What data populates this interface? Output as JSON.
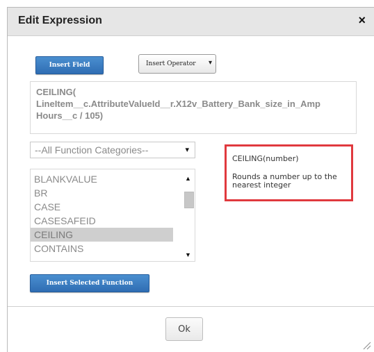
{
  "dialog": {
    "title": "Edit Expression",
    "close_icon": "×"
  },
  "toolbar": {
    "insert_field_label": "Insert Field",
    "insert_operator_label": "Insert Operator",
    "insert_operator_arrow": "▾"
  },
  "expression": {
    "value": "CEILING(\nLineItem__c.AttributeValueId__r.X12v_Battery_Bank_size_in_Amp\nHours__c / 105)"
  },
  "function_category": {
    "selected": "--All Function Categories--",
    "caret": "▾"
  },
  "function_list": {
    "items": [
      "BLANKVALUE",
      "BR",
      "CASE",
      "CASESAFEID",
      "CEILING",
      "CONTAINS"
    ],
    "selected": "CEILING"
  },
  "help": {
    "signature": "CEILING(number)",
    "description": "Rounds a number up to the nearest integer"
  },
  "insert_selected_function_label": "Insert Selected Function",
  "ok_label": "Ok",
  "colors": {
    "accent_blue": "#2f6db3",
    "highlight_red": "#e0393e",
    "selected_bg": "#cfcfcf"
  }
}
